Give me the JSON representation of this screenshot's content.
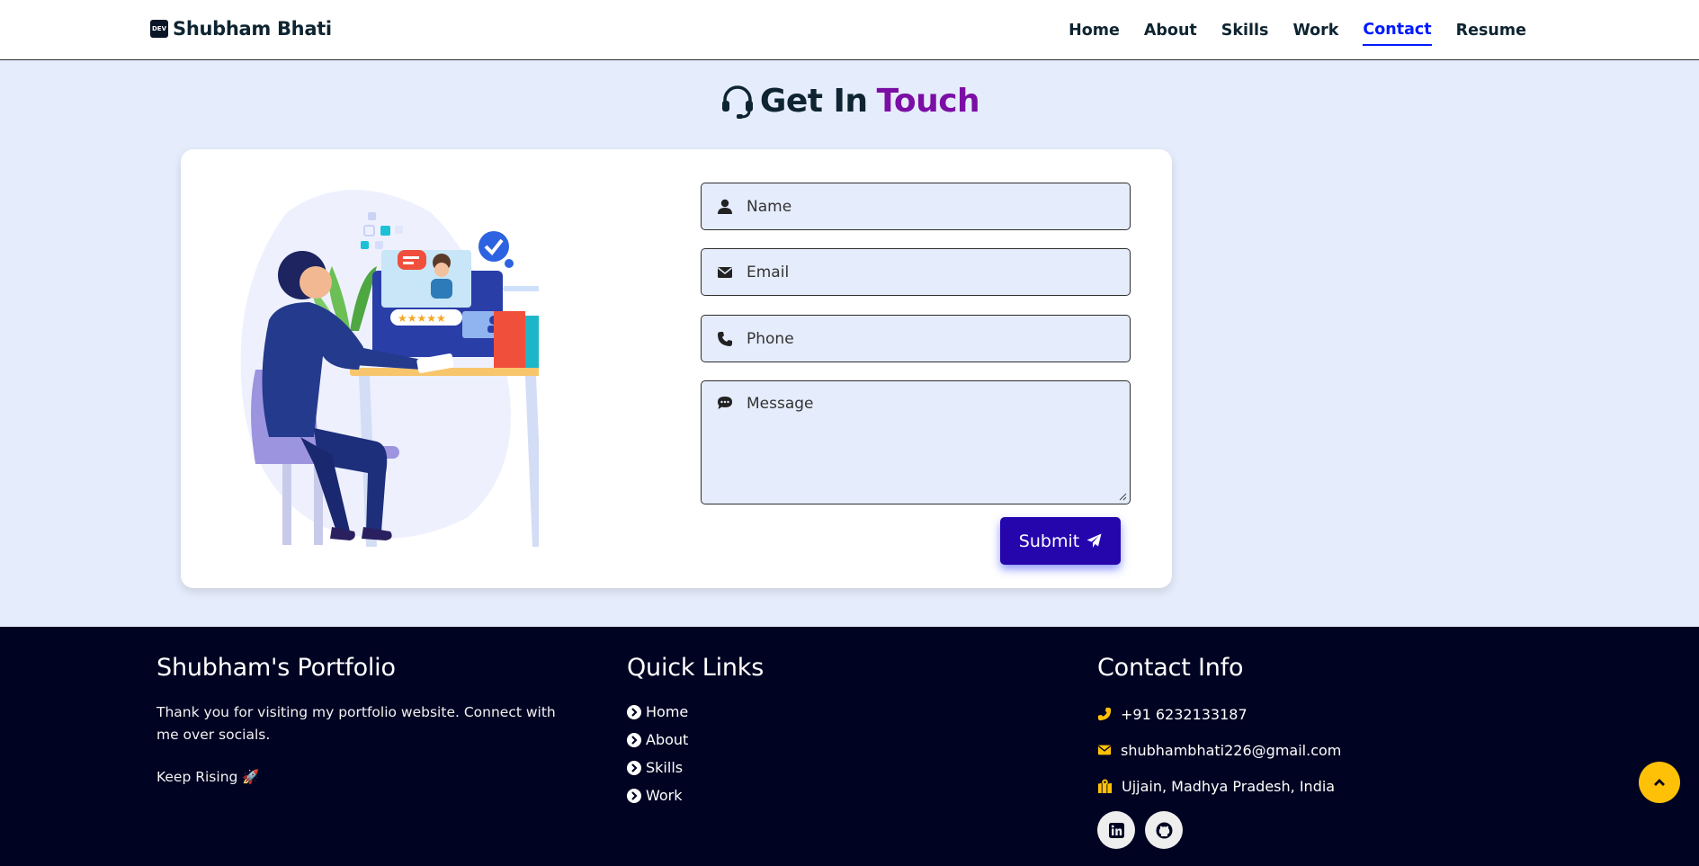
{
  "header": {
    "logo_badge": "DEV",
    "logo_text": "Shubham Bhati",
    "nav": [
      {
        "label": "Home"
      },
      {
        "label": "About"
      },
      {
        "label": "Skills"
      },
      {
        "label": "Work"
      },
      {
        "label": "Contact",
        "active": true
      },
      {
        "label": "Resume"
      }
    ]
  },
  "contact": {
    "heading_main": "Get In",
    "heading_accent": "Touch",
    "heading_icon": "headset-icon",
    "illustration": "person-at-desk-video-call-illustration",
    "fields": {
      "name": {
        "placeholder": "Name",
        "icon": "user-icon"
      },
      "email": {
        "placeholder": "Email",
        "icon": "envelope-icon"
      },
      "phone": {
        "placeholder": "Phone",
        "icon": "phone-icon"
      },
      "message": {
        "placeholder": "Message",
        "icon": "comment-dots-icon"
      }
    },
    "submit_label": "Submit",
    "submit_icon": "paper-plane-icon"
  },
  "footer": {
    "about": {
      "title": "Shubham's Portfolio",
      "text": "Thank you for visiting my portfolio website. Connect with me over socials.",
      "tagline": "Keep Rising 🚀"
    },
    "quick_links": {
      "title": "Quick Links",
      "items": [
        "Home",
        "About",
        "Skills",
        "Work"
      ]
    },
    "contact_info": {
      "title": "Contact Info",
      "phone": "+91 6232133187",
      "email": "shubhambhati226@gmail.com",
      "location": "Ujjain, Madhya Pradesh, India"
    },
    "socials": [
      "linkedin-icon",
      "github-icon"
    ]
  },
  "colors": {
    "accent_purple": "#7b0ea5",
    "nav_active": "#011aff",
    "submit_bg": "#2506ad",
    "footer_bg": "#000322",
    "footer_icon": "#ffc107",
    "section_bg": "#e5ecfb"
  }
}
